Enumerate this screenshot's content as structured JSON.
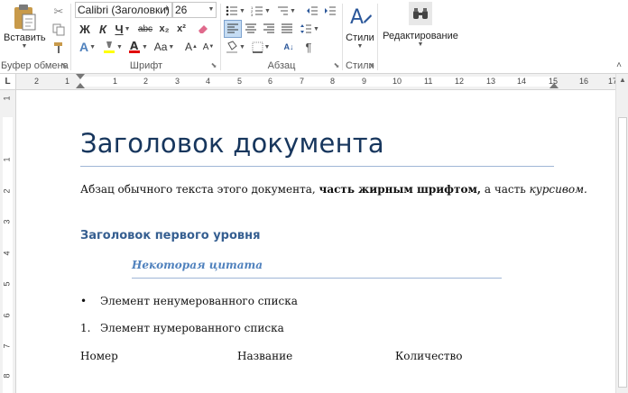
{
  "ribbon": {
    "clipboard": {
      "paste_label": "Вставить",
      "group_label": "Буфер обмена"
    },
    "font": {
      "font_name": "Calibri (Заголовки)",
      "font_size": "26",
      "bold": "Ж",
      "italic": "К",
      "underline": "Ч",
      "strike": "abc",
      "subscript": "x₂",
      "superscript": "x²",
      "grow": "A",
      "shrink": "A",
      "case": "Aa",
      "group_label": "Шрифт"
    },
    "paragraph": {
      "group_label": "Абзац",
      "pilcrow": "¶"
    },
    "styles": {
      "label": "Стили",
      "group_label": "Стили"
    },
    "editing": {
      "label": "Редактирование"
    }
  },
  "ruler": {
    "corner": "L",
    "h_numbers": [
      "2",
      "1",
      "1",
      "2",
      "3",
      "4",
      "5",
      "6",
      "7",
      "8",
      "9",
      "10",
      "11",
      "12",
      "13",
      "14",
      "15",
      "16",
      "17"
    ],
    "v_numbers": [
      "1",
      "1",
      "2",
      "3",
      "4",
      "5",
      "6",
      "7",
      "8"
    ]
  },
  "document": {
    "title": "Заголовок документа",
    "para_normal": "Абзац обычного текста этого документа, ",
    "para_bold": "часть жирным шрифтом,",
    "para_normal2": " а часть ",
    "para_italic": "курсивом.",
    "heading1": "Заголовок первого уровня",
    "quote": "Некоторая цитата",
    "bullet_marker": "•",
    "bullet_item": "Элемент ненумерованного списка",
    "number_marker": "1.",
    "number_item": "Элемент нумерованного списка",
    "table_headers": [
      "Номер",
      "Название",
      "Количество"
    ]
  },
  "colors": {
    "heading_title": "#17365d",
    "heading1": "#365f91",
    "quote": "#4f81bd",
    "accent_blue": "#2b579a"
  }
}
